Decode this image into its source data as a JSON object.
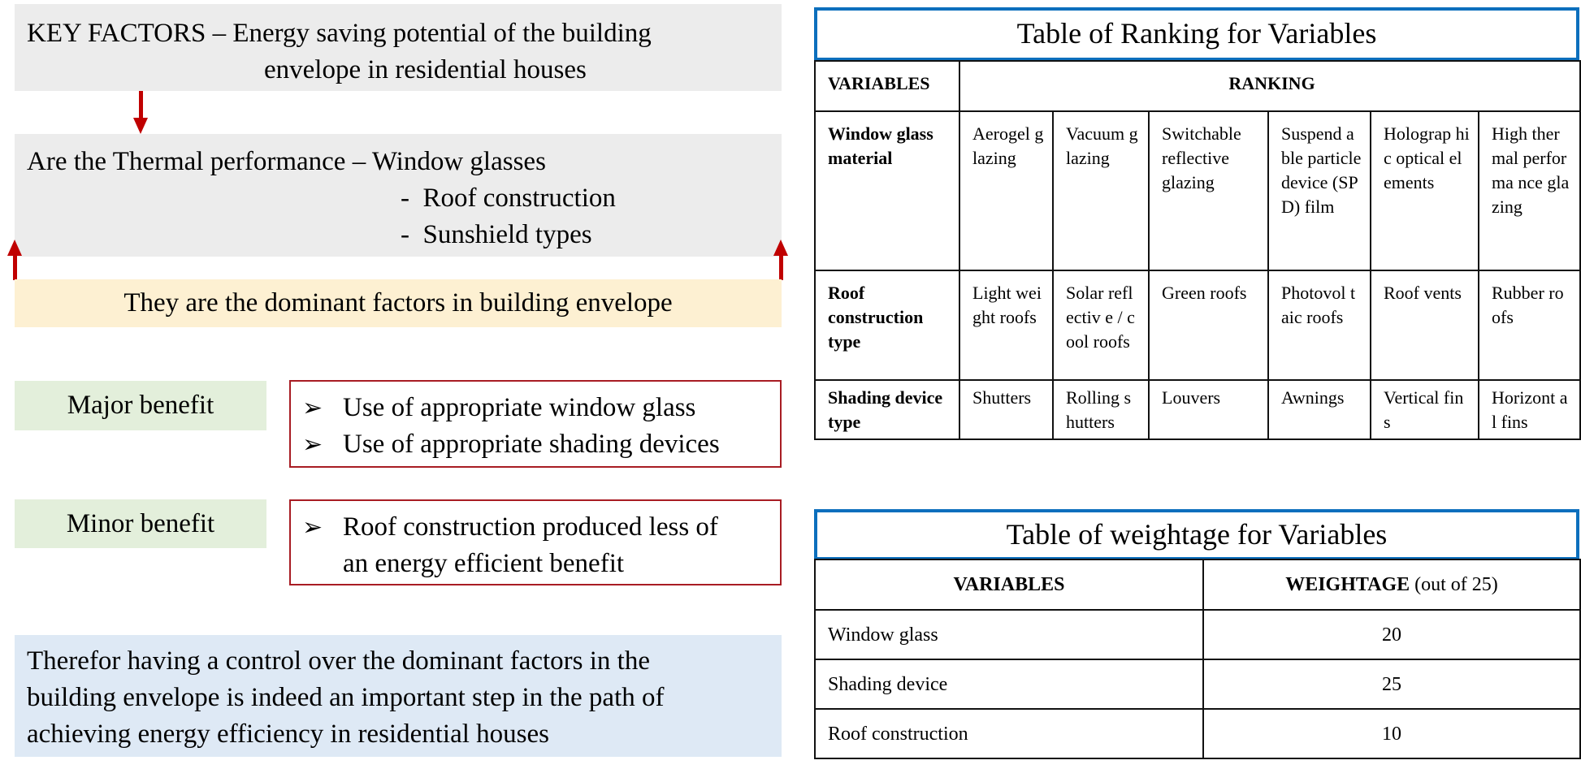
{
  "left": {
    "key_factors": {
      "line1": "KEY FACTORS – Energy saving potential of the building",
      "line2": "envelope in residential houses"
    },
    "thermal": {
      "intro": "Are the Thermal performance – Window glasses",
      "items": [
        "-  Roof construction",
        "-  Sunshield types"
      ]
    },
    "dominant": "They are the dominant factors in building envelope",
    "major": {
      "label": "Major benefit",
      "bullets": [
        "Use of appropriate window glass",
        "Use of appropriate shading devices"
      ]
    },
    "minor": {
      "label": "Minor benefit",
      "bullets": [
        "Roof construction produced less of",
        "an energy efficient benefit"
      ]
    },
    "conclusion": [
      "Therefor having a control over the dominant factors in the",
      "building envelope is indeed an important step in the path of",
      "achieving energy efficiency in residential houses"
    ],
    "bullet_icon": "➢",
    "colors": {
      "arrow": "#c00000",
      "gray_box": "#ececec",
      "yellow_box": "#fdf0d2",
      "green_box": "#e3efdb",
      "blue_box": "#dee9f5",
      "red_border": "#a81c23"
    }
  },
  "ranking_table": {
    "title": "Table of Ranking for Variables",
    "headers": [
      "VARIABLES",
      "RANKING"
    ],
    "rows": [
      {
        "variable": "Window glass material",
        "ranks": [
          "Aerogel glazing",
          "Vacuum glazing",
          "Switchable reflective glazing",
          "Suspend able particle device (SPD) film",
          "Holograp hic optical elements",
          "High thermal performa nce glazing"
        ]
      },
      {
        "variable": "Roof construction type",
        "ranks": [
          "Light weight roofs",
          "Solar reflectiv e / cool roofs",
          "Green roofs",
          "Photovol taic roofs",
          "Roof vents",
          "Rubber roofs"
        ]
      },
      {
        "variable": "Shading device type",
        "ranks": [
          "Shutters",
          "Rolling shutters",
          "Louvers",
          "Awnings",
          "Vertical fins",
          "Horizont al fins"
        ]
      }
    ],
    "accent": "#0c6fbd"
  },
  "weightage_table": {
    "title": "Table of weightage for Variables",
    "headers": {
      "variables": "VARIABLES",
      "weightage_bold": "WEIGHTAGE",
      "weightage_note": " (out of 25)"
    },
    "rows": [
      {
        "variable": "Window glass",
        "weight": "20"
      },
      {
        "variable": "Shading device",
        "weight": "25"
      },
      {
        "variable": "Roof construction",
        "weight": "10"
      }
    ]
  }
}
